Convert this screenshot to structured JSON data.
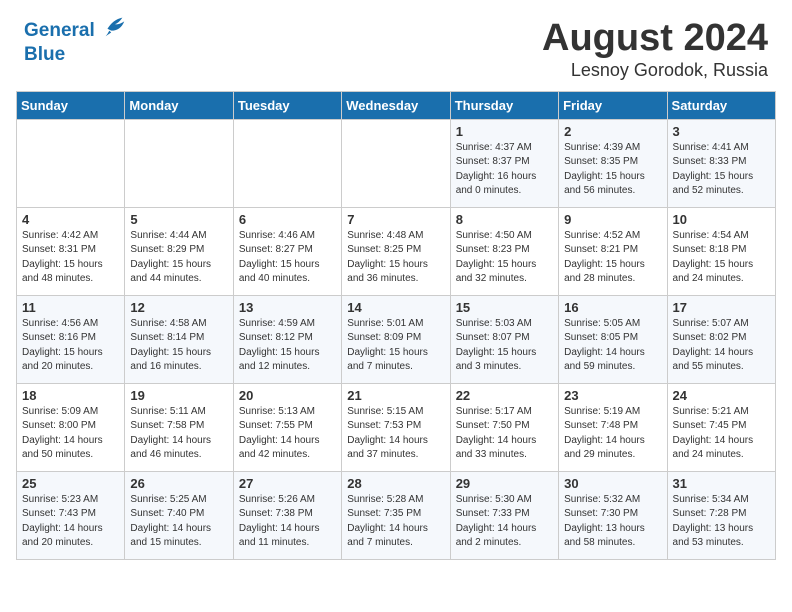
{
  "header": {
    "logo_line1": "General",
    "logo_line2": "Blue",
    "title": "August 2024",
    "subtitle": "Lesnoy Gorodok, Russia"
  },
  "weekdays": [
    "Sunday",
    "Monday",
    "Tuesday",
    "Wednesday",
    "Thursday",
    "Friday",
    "Saturday"
  ],
  "weeks": [
    [
      {
        "num": "",
        "info": ""
      },
      {
        "num": "",
        "info": ""
      },
      {
        "num": "",
        "info": ""
      },
      {
        "num": "",
        "info": ""
      },
      {
        "num": "1",
        "info": "Sunrise: 4:37 AM\nSunset: 8:37 PM\nDaylight: 16 hours\nand 0 minutes."
      },
      {
        "num": "2",
        "info": "Sunrise: 4:39 AM\nSunset: 8:35 PM\nDaylight: 15 hours\nand 56 minutes."
      },
      {
        "num": "3",
        "info": "Sunrise: 4:41 AM\nSunset: 8:33 PM\nDaylight: 15 hours\nand 52 minutes."
      }
    ],
    [
      {
        "num": "4",
        "info": "Sunrise: 4:42 AM\nSunset: 8:31 PM\nDaylight: 15 hours\nand 48 minutes."
      },
      {
        "num": "5",
        "info": "Sunrise: 4:44 AM\nSunset: 8:29 PM\nDaylight: 15 hours\nand 44 minutes."
      },
      {
        "num": "6",
        "info": "Sunrise: 4:46 AM\nSunset: 8:27 PM\nDaylight: 15 hours\nand 40 minutes."
      },
      {
        "num": "7",
        "info": "Sunrise: 4:48 AM\nSunset: 8:25 PM\nDaylight: 15 hours\nand 36 minutes."
      },
      {
        "num": "8",
        "info": "Sunrise: 4:50 AM\nSunset: 8:23 PM\nDaylight: 15 hours\nand 32 minutes."
      },
      {
        "num": "9",
        "info": "Sunrise: 4:52 AM\nSunset: 8:21 PM\nDaylight: 15 hours\nand 28 minutes."
      },
      {
        "num": "10",
        "info": "Sunrise: 4:54 AM\nSunset: 8:18 PM\nDaylight: 15 hours\nand 24 minutes."
      }
    ],
    [
      {
        "num": "11",
        "info": "Sunrise: 4:56 AM\nSunset: 8:16 PM\nDaylight: 15 hours\nand 20 minutes."
      },
      {
        "num": "12",
        "info": "Sunrise: 4:58 AM\nSunset: 8:14 PM\nDaylight: 15 hours\nand 16 minutes."
      },
      {
        "num": "13",
        "info": "Sunrise: 4:59 AM\nSunset: 8:12 PM\nDaylight: 15 hours\nand 12 minutes."
      },
      {
        "num": "14",
        "info": "Sunrise: 5:01 AM\nSunset: 8:09 PM\nDaylight: 15 hours\nand 7 minutes."
      },
      {
        "num": "15",
        "info": "Sunrise: 5:03 AM\nSunset: 8:07 PM\nDaylight: 15 hours\nand 3 minutes."
      },
      {
        "num": "16",
        "info": "Sunrise: 5:05 AM\nSunset: 8:05 PM\nDaylight: 14 hours\nand 59 minutes."
      },
      {
        "num": "17",
        "info": "Sunrise: 5:07 AM\nSunset: 8:02 PM\nDaylight: 14 hours\nand 55 minutes."
      }
    ],
    [
      {
        "num": "18",
        "info": "Sunrise: 5:09 AM\nSunset: 8:00 PM\nDaylight: 14 hours\nand 50 minutes."
      },
      {
        "num": "19",
        "info": "Sunrise: 5:11 AM\nSunset: 7:58 PM\nDaylight: 14 hours\nand 46 minutes."
      },
      {
        "num": "20",
        "info": "Sunrise: 5:13 AM\nSunset: 7:55 PM\nDaylight: 14 hours\nand 42 minutes."
      },
      {
        "num": "21",
        "info": "Sunrise: 5:15 AM\nSunset: 7:53 PM\nDaylight: 14 hours\nand 37 minutes."
      },
      {
        "num": "22",
        "info": "Sunrise: 5:17 AM\nSunset: 7:50 PM\nDaylight: 14 hours\nand 33 minutes."
      },
      {
        "num": "23",
        "info": "Sunrise: 5:19 AM\nSunset: 7:48 PM\nDaylight: 14 hours\nand 29 minutes."
      },
      {
        "num": "24",
        "info": "Sunrise: 5:21 AM\nSunset: 7:45 PM\nDaylight: 14 hours\nand 24 minutes."
      }
    ],
    [
      {
        "num": "25",
        "info": "Sunrise: 5:23 AM\nSunset: 7:43 PM\nDaylight: 14 hours\nand 20 minutes."
      },
      {
        "num": "26",
        "info": "Sunrise: 5:25 AM\nSunset: 7:40 PM\nDaylight: 14 hours\nand 15 minutes."
      },
      {
        "num": "27",
        "info": "Sunrise: 5:26 AM\nSunset: 7:38 PM\nDaylight: 14 hours\nand 11 minutes."
      },
      {
        "num": "28",
        "info": "Sunrise: 5:28 AM\nSunset: 7:35 PM\nDaylight: 14 hours\nand 7 minutes."
      },
      {
        "num": "29",
        "info": "Sunrise: 5:30 AM\nSunset: 7:33 PM\nDaylight: 14 hours\nand 2 minutes."
      },
      {
        "num": "30",
        "info": "Sunrise: 5:32 AM\nSunset: 7:30 PM\nDaylight: 13 hours\nand 58 minutes."
      },
      {
        "num": "31",
        "info": "Sunrise: 5:34 AM\nSunset: 7:28 PM\nDaylight: 13 hours\nand 53 minutes."
      }
    ]
  ]
}
